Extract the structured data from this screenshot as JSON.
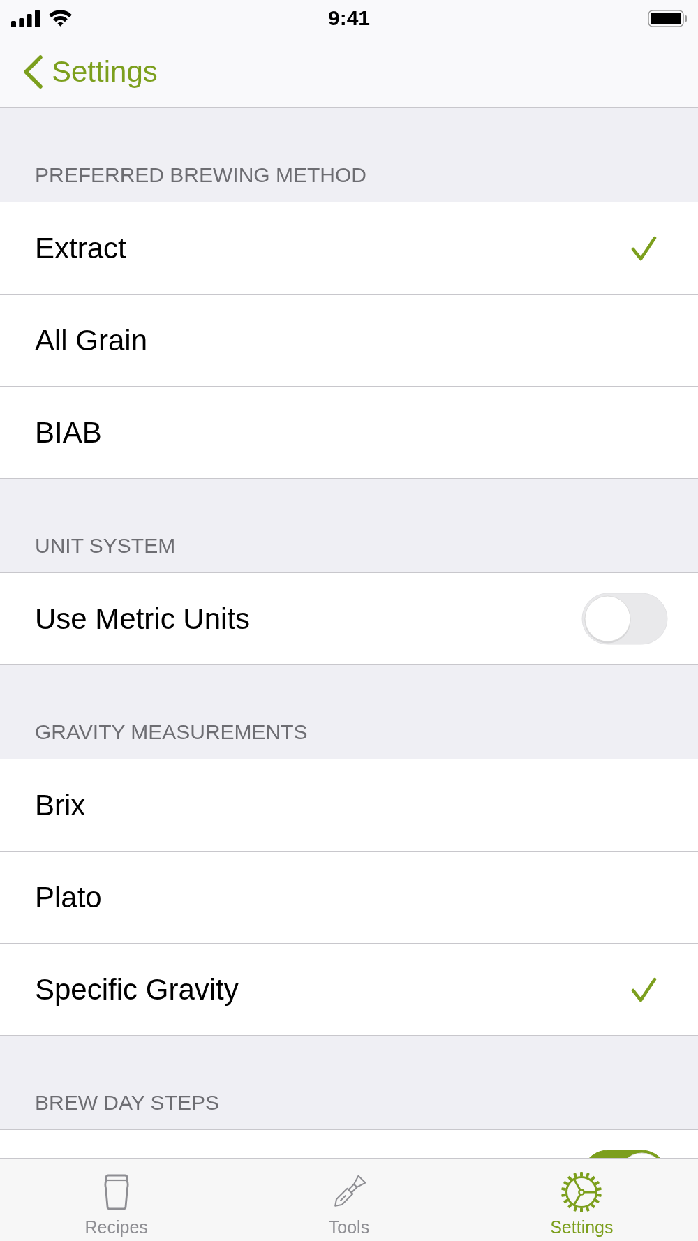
{
  "status_bar": {
    "time": "9:41"
  },
  "nav_bar": {
    "back_label": "Settings"
  },
  "sections": [
    {
      "header": "PREFERRED BREWING METHOD",
      "rows": [
        {
          "kind": "option",
          "label": "Extract",
          "selected": true
        },
        {
          "kind": "option",
          "label": "All Grain",
          "selected": false
        },
        {
          "kind": "option",
          "label": "BIAB",
          "selected": false
        }
      ]
    },
    {
      "header": "UNIT SYSTEM",
      "rows": [
        {
          "kind": "toggle",
          "label": "Use Metric Units",
          "on": false
        }
      ]
    },
    {
      "header": "GRAVITY MEASUREMENTS",
      "rows": [
        {
          "kind": "option",
          "label": "Brix",
          "selected": false
        },
        {
          "kind": "option",
          "label": "Plato",
          "selected": false
        },
        {
          "kind": "option",
          "label": "Specific Gravity",
          "selected": true
        }
      ]
    },
    {
      "header": "BREW DAY STEPS",
      "rows": [
        {
          "kind": "toggle",
          "on": true
        }
      ]
    }
  ],
  "tab_bar": [
    {
      "label": "Recipes",
      "selected": false
    },
    {
      "label": "Tools",
      "selected": false
    },
    {
      "label": "Settings",
      "selected": true
    }
  ]
}
